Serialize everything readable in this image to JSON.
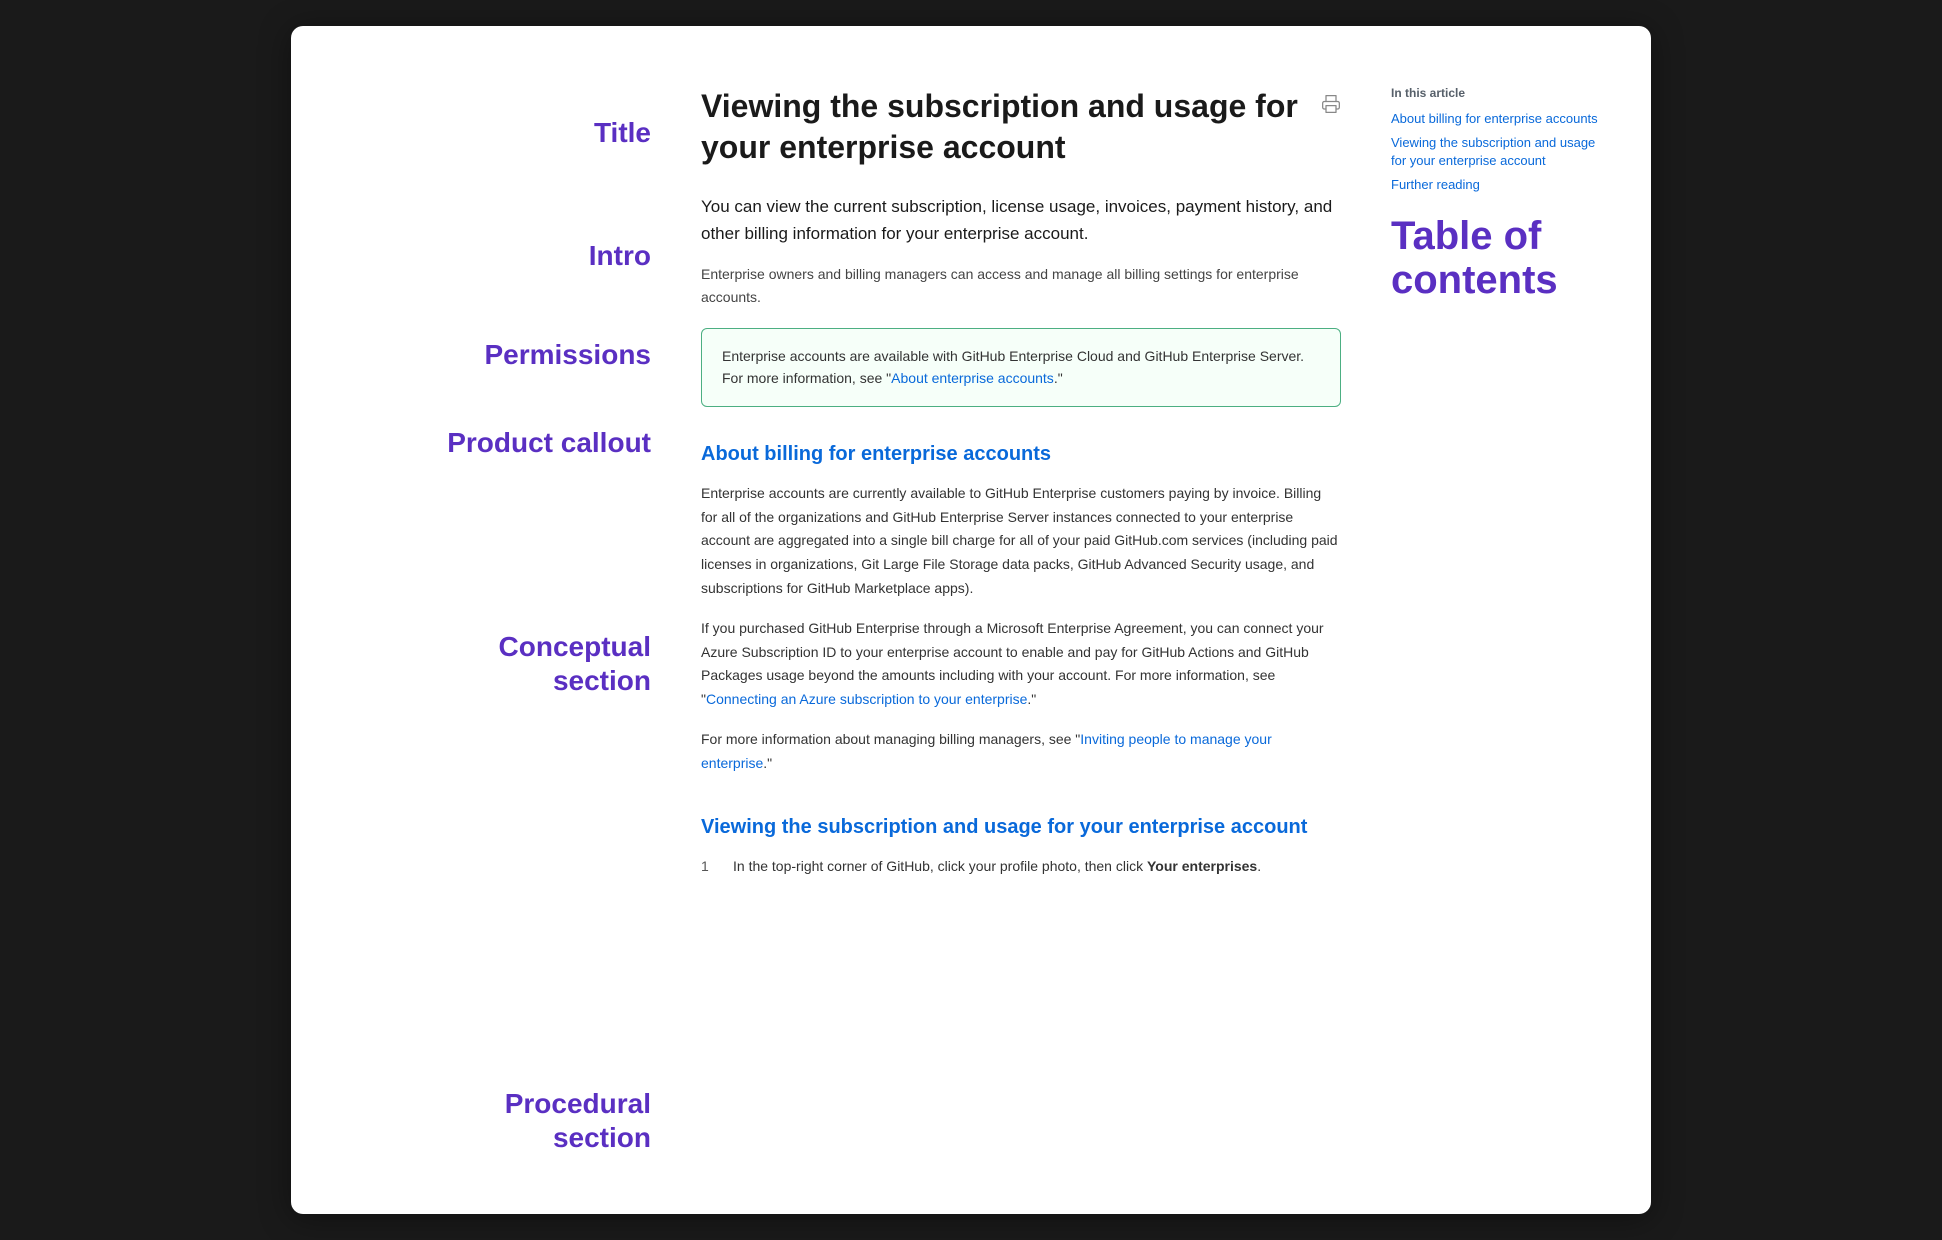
{
  "window": {
    "background": "#ffffff"
  },
  "annotations": {
    "title_label": "Title",
    "intro_label": "Intro",
    "permissions_label": "Permissions",
    "product_callout_label": "Product callout",
    "conceptual_section_label": "Conceptual\nsection",
    "procedural_section_label": "Procedural\nsection"
  },
  "article": {
    "title": "Viewing the subscription and usage for your enterprise account",
    "intro": "You can view the current subscription, license usage, invoices, payment history, and other billing information for your enterprise account.",
    "permissions": "Enterprise owners and billing managers can access and manage all billing settings for enterprise accounts.",
    "product_callout": "Enterprise accounts are available with GitHub Enterprise Cloud and GitHub Enterprise Server. For more information, see \"About enterprise accounts.\"",
    "product_callout_link_text": "About enterprise accounts",
    "conceptual_heading": "About billing for enterprise accounts",
    "conceptual_p1": "Enterprise accounts are currently available to GitHub Enterprise customers paying by invoice. Billing for all of the organizations and GitHub Enterprise Server instances connected to your enterprise account are aggregated into a single bill charge for all of your paid GitHub.com services (including paid licenses in organizations, Git Large File Storage data packs, GitHub Advanced Security usage, and subscriptions for GitHub Marketplace apps).",
    "conceptual_p2_prefix": "If you purchased GitHub Enterprise through a Microsoft Enterprise Agreement, you can connect your Azure Subscription ID to your enterprise account to enable and pay for GitHub Actions and GitHub Packages usage beyond the amounts including with your account. For more information, see \"",
    "conceptual_p2_link_text": "Connecting an Azure subscription to your enterprise",
    "conceptual_p2_suffix": ".\"",
    "conceptual_p3_prefix": "For more information about managing billing managers, see \"",
    "conceptual_p3_link_text": "Inviting people to manage your enterprise",
    "conceptual_p3_suffix": ".\"",
    "procedural_heading": "Viewing the subscription and usage for your enterprise account",
    "step1_prefix": "In the top-right corner of GitHub, click your profile photo, then click ",
    "step1_bold": "Your enterprises",
    "step1_suffix": "."
  },
  "toc": {
    "in_this_article": "In this article",
    "link1": "About billing for enterprise accounts",
    "link2": "Viewing the subscription and usage for your enterprise account",
    "link3": "Further reading",
    "heading_line1": "Table of",
    "heading_line2": "contents"
  },
  "icons": {
    "print": "🖨"
  }
}
